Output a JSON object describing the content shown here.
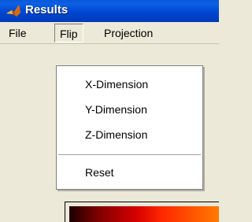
{
  "window": {
    "title": "Results"
  },
  "menubar": {
    "file": "File",
    "flip": "Flip",
    "projection": "Projection"
  },
  "flip_menu": {
    "items": [
      "X-Dimension",
      "Y-Dimension",
      "Z-Dimension"
    ],
    "reset": "Reset"
  },
  "colors": {
    "titlebar": "#0046d0",
    "menu_bg": "#ece9d8",
    "dropdown_bg": "#ffffff"
  },
  "icons": {
    "app": "matlab-icon"
  }
}
